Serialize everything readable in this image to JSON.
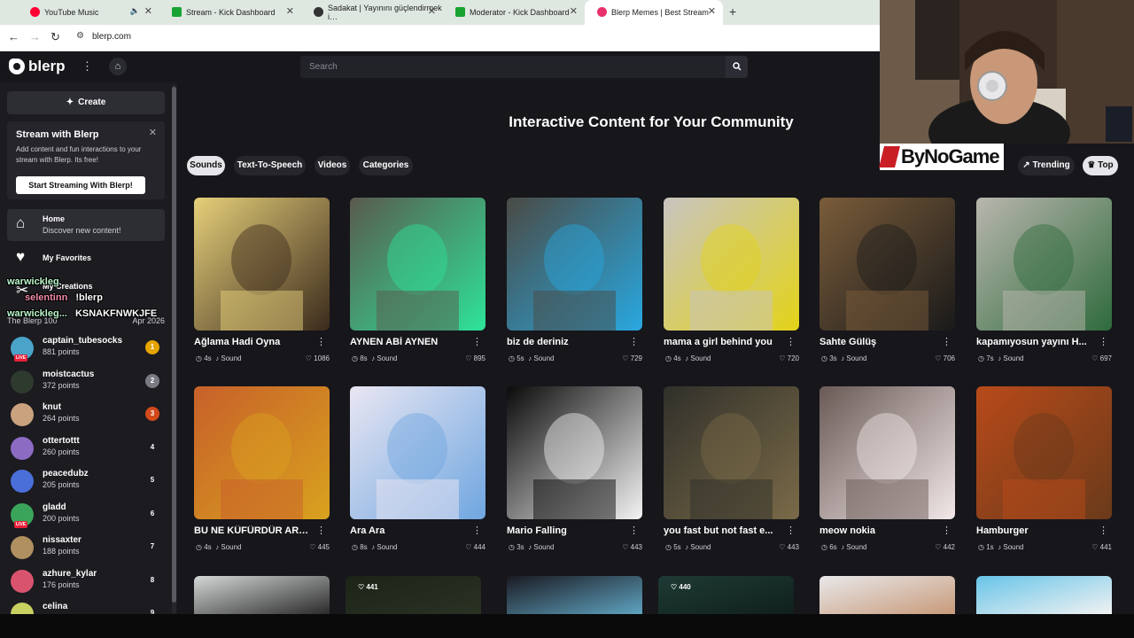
{
  "browser": {
    "tabs": [
      {
        "label": "YouTube Music",
        "favicon_color": "#ff0033"
      },
      {
        "label": "Stream - Kick Dashboard",
        "favicon_color": "#19a332"
      },
      {
        "label": "Sadakat | Yayınını güçlendirmek i…",
        "favicon_color": "#333333"
      },
      {
        "label": "Moderator - Kick Dashboard",
        "favicon_color": "#19a332"
      },
      {
        "label": "Blerp Memes | Best Streamer Sou…",
        "favicon_color": "#e8306a"
      }
    ],
    "url": "blerp.com",
    "new_tab": "+"
  },
  "header": {
    "brand": "blerp",
    "search_placeholder": "Search"
  },
  "sidebar": {
    "create_label": "Create",
    "promo": {
      "title": "Stream with Blerp",
      "body": "Add content and fun interactions to your stream with Blerp. Its free!",
      "button": "Start Streaming With Blerp!"
    },
    "nav": [
      {
        "title": "Home",
        "subtitle": "Discover new content!"
      },
      {
        "title": "My Favorites"
      },
      {
        "title": "My Creations"
      }
    ],
    "leaderboard": {
      "title": "The Blerp 100",
      "date": "Apr 2026",
      "rows": [
        {
          "name": "captain_tubesocks",
          "points": "881 points",
          "rank": "1",
          "live": true,
          "rank_color": "#e5a400",
          "avatar_color": "#4aa3c9"
        },
        {
          "name": "moistcactus",
          "points": "372 points",
          "rank": "2",
          "live": false,
          "rank_color": "#7a7a82",
          "avatar_color": "#2f3a2f"
        },
        {
          "name": "knut",
          "points": "264 points",
          "rank": "3",
          "live": false,
          "rank_color": "#d24a1a",
          "avatar_color": "#c9a27e"
        },
        {
          "name": "ottertottt",
          "points": "260 points",
          "rank": "4",
          "live": false,
          "rank_color": "#1b1b20",
          "avatar_color": "#8c6bc3"
        },
        {
          "name": "peacedubz",
          "points": "205 points",
          "rank": "5",
          "live": false,
          "rank_color": "#1b1b20",
          "avatar_color": "#4a6fd9"
        },
        {
          "name": "gladd",
          "points": "200 points",
          "rank": "6",
          "live": true,
          "rank_color": "#1b1b20",
          "avatar_color": "#3aa55a"
        },
        {
          "name": "nissaxter",
          "points": "188 points",
          "rank": "7",
          "live": false,
          "rank_color": "#1b1b20",
          "avatar_color": "#b09060"
        },
        {
          "name": "azhure_kylar",
          "points": "176 points",
          "rank": "8",
          "live": false,
          "rank_color": "#1b1b20",
          "avatar_color": "#d9536e"
        },
        {
          "name": "celina",
          "points": "",
          "rank": "9",
          "live": false,
          "rank_color": "#1b1b20",
          "avatar_color": "#c8d060"
        }
      ]
    }
  },
  "chat_overlay": [
    {
      "name": "warwickleg",
      "message": "",
      "name_color": "#b8f5c8"
    },
    {
      "name": "selentinn",
      "message": "!blerp",
      "name_color": "#f08aa7"
    },
    {
      "name": "warwickleg...",
      "message": "KSNAKFNWKJFE",
      "name_color": "#b8f5c8"
    }
  ],
  "main": {
    "title": "Interactive Content for Your Community",
    "tabs": [
      "Sounds",
      "Text-To-Speech",
      "Videos",
      "Categories"
    ],
    "active_tab": "Sounds",
    "sort": [
      "Trending",
      "Top"
    ],
    "active_sort": "Top",
    "type_label": "Sound",
    "cards": [
      {
        "title": "Ağlama Hadi Oyna",
        "duration": "4s",
        "likes": "1086",
        "c1": "#e6d07a",
        "c2": "#3b2a1c"
      },
      {
        "title": "AYNEN ABİ AYNEN",
        "duration": "8s",
        "likes": "895",
        "c1": "#5a5a4e",
        "c2": "#2ee39a"
      },
      {
        "title": "biz de deriniz",
        "duration": "5s",
        "likes": "729",
        "c1": "#4a4a44",
        "c2": "#29a8e0"
      },
      {
        "title": "mama a girl behind you",
        "duration": "4s",
        "likes": "720",
        "c1": "#c8c4c0",
        "c2": "#e3d318"
      },
      {
        "title": "Sahte Gülüş",
        "duration": "3s",
        "likes": "706",
        "c1": "#7a5c3a",
        "c2": "#1a1a1a"
      },
      {
        "title": "kapamıyosun yayını H...",
        "duration": "7s",
        "likes": "697",
        "c1": "#b9b6ae",
        "c2": "#2f6b3c"
      },
      {
        "title": "BU NE KÜFÜRDÜR ARK...",
        "duration": "4s",
        "likes": "445",
        "c1": "#c7602a",
        "c2": "#d9a21e"
      },
      {
        "title": "Ara Ara",
        "duration": "8s",
        "likes": "444",
        "c1": "#e9e6f2",
        "c2": "#6fa6e0"
      },
      {
        "title": "Mario Falling",
        "duration": "3s",
        "likes": "443",
        "c1": "#0a0a0a",
        "c2": "#f4f4f4"
      },
      {
        "title": "you fast but not fast e...",
        "duration": "5s",
        "likes": "443",
        "c1": "#30302a",
        "c2": "#7a6a48"
      },
      {
        "title": "meow nokia",
        "duration": "6s",
        "likes": "442",
        "c1": "#6a5a56",
        "c2": "#f2e8e8"
      },
      {
        "title": "Hamburger",
        "duration": "1s",
        "likes": "441",
        "c1": "#b84a1a",
        "c2": "#6a3a1a"
      }
    ],
    "third_row": [
      {
        "likes": "",
        "c1": "#d4d8d6",
        "c2": "#2a2a2a"
      },
      {
        "likes": "441",
        "c1": "#1c2418",
        "c2": "#2a3224"
      },
      {
        "likes": "",
        "c1": "#1a1a22",
        "c2": "#5fa3c0"
      },
      {
        "likes": "440",
        "c1": "#1e3a34",
        "c2": "#10201c"
      },
      {
        "likes": "",
        "c1": "#e8e8ea",
        "c2": "#c89a7a"
      },
      {
        "likes": "",
        "c1": "#67c4e8",
        "c2": "#f2f2f2"
      }
    ]
  },
  "overlay": {
    "sponsor": "ByNoGame"
  }
}
